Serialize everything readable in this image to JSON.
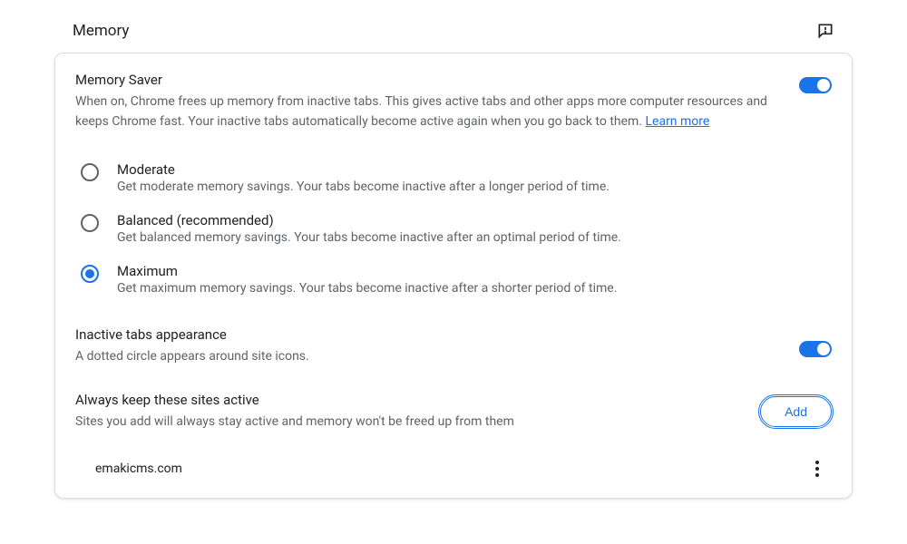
{
  "header": {
    "title": "Memory"
  },
  "memorySaver": {
    "title": "Memory Saver",
    "description": "When on, Chrome frees up memory from inactive tabs. This gives active tabs and other apps more computer resources and keeps Chrome fast. Your inactive tabs automatically become active again when you go back to them. ",
    "learnMore": "Learn more",
    "enabled": true
  },
  "options": [
    {
      "label": "Moderate",
      "description": "Get moderate memory savings. Your tabs become inactive after a longer period of time.",
      "selected": false
    },
    {
      "label": "Balanced (recommended)",
      "description": "Get balanced memory savings. Your tabs become inactive after an optimal period of time.",
      "selected": false
    },
    {
      "label": "Maximum",
      "description": "Get maximum memory savings. Your tabs become inactive after a shorter period of time.",
      "selected": true
    }
  ],
  "inactiveTabs": {
    "title": "Inactive tabs appearance",
    "description": "A dotted circle appears around site icons.",
    "enabled": true
  },
  "alwaysActive": {
    "title": "Always keep these sites active",
    "description": "Sites you add will always stay active and memory won't be freed up from them",
    "addLabel": "Add"
  },
  "sites": [
    {
      "url": "emakicms.com"
    }
  ]
}
